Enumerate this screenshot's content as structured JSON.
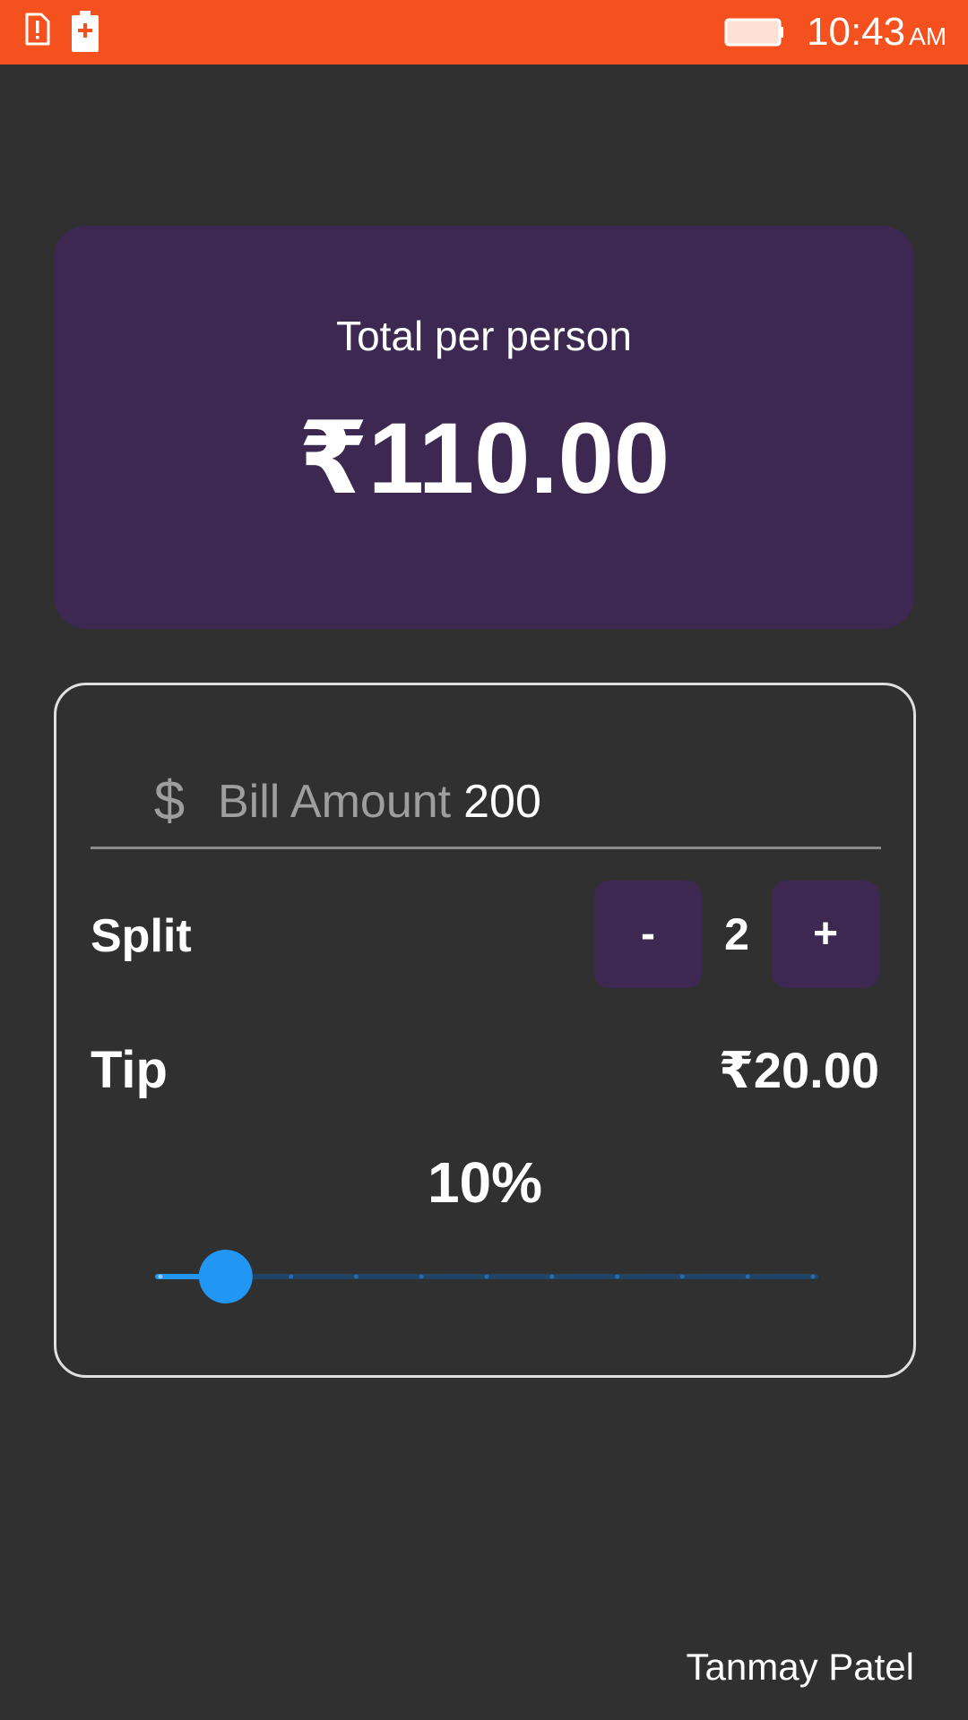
{
  "status_bar": {
    "time": "10:43",
    "ampm": "AM",
    "icons": [
      "sim-alert-icon",
      "battery-saver-icon",
      "battery-icon"
    ],
    "color": "#F4511E"
  },
  "summary": {
    "label": "Total per person",
    "amount": "₹110.00",
    "card_color": "#3C2850"
  },
  "bill": {
    "icon_text": "$",
    "label": "Bill Amount",
    "value": "200"
  },
  "split": {
    "label": "Split",
    "minus_label": "-",
    "count": "2",
    "plus_label": "+"
  },
  "tip": {
    "label": "Tip",
    "amount": "₹20.00",
    "percent_label": "10%",
    "slider_value": 0.1,
    "slider_steps": 10,
    "accent_color": "#2196F3"
  },
  "footer": {
    "author": "Tanmay Patel"
  }
}
